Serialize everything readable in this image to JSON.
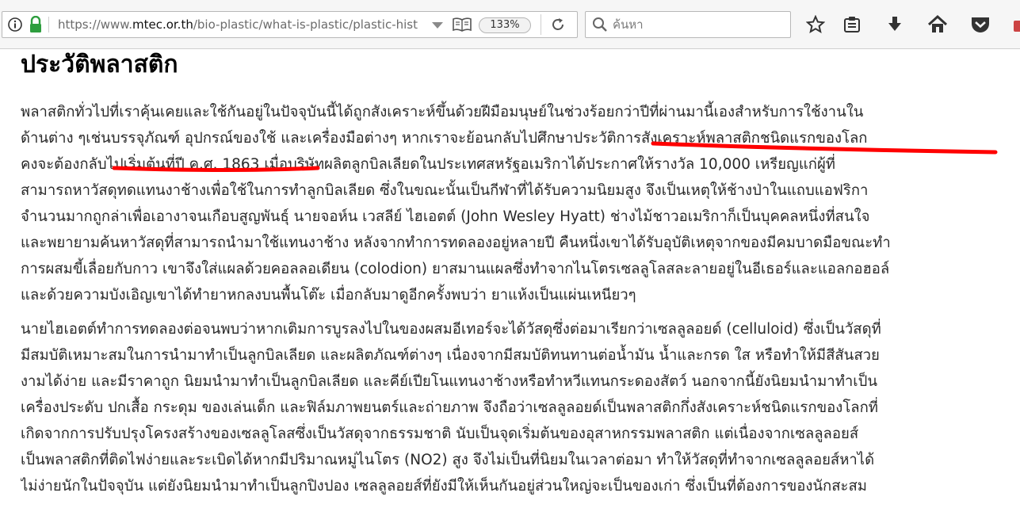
{
  "browser": {
    "url_prefix": "https://www.",
    "url_host": "mtec.or.th",
    "url_path": "/bio-plastic/what-is-plastic/plastic-hist",
    "zoom": "133%",
    "search_placeholder": "ค้นหา",
    "icons": [
      "info-icon",
      "lock-icon",
      "dropdown-icon",
      "reader-view-icon",
      "reload-icon",
      "search-icon",
      "bookmark-star-icon",
      "bookmarks-list-icon",
      "download-icon",
      "home-icon",
      "pocket-icon"
    ],
    "colors": {
      "toolbar": "#f6f6f6",
      "lock": "#2e9e3e",
      "annotation": "#ff0000"
    }
  },
  "page": {
    "title": "ประวัติพลาสติก",
    "paragraphs": [
      {
        "lines": [
          "พลาสติกทั่วไปที่เราคุ้นเคยและใช้กันอยู่ในปัจจุบันนี้ได้ถูกสังเคราะห์ขึ้นด้วยฝีมือมนุษย์ในช่วงร้อยกว่าปีที่ผ่านมานี้เองสำหรับการใช้งานใน",
          "ด้านต่าง ๆเช่นบรรจุภัณฑ์ อุปกรณ์ของใช้ และเครื่องมือต่างๆ หากเราจะย้อนกลับไปศึกษาประวัติการสังเคราะห์พลาสติกชนิดแรกของโลก",
          "คงจะต้องกลับไปเริ่มต้นที่ปี ค.ศ. 1863 เมื่อบริษัทผลิตลูกบิลเลียดในประเทศสหรัฐอเมริกาได้ประกาศให้รางวัล 10,000 เหรียญแก่ผู้ที่",
          "สามารถหาวัสดุทดแทนงาช้างเพื่อใช้ในการทำลูกบิลเลียด ซึ่งในขณะนั้นเป็นกีฬาที่ได้รับความนิยมสูง จึงเป็นเหตุให้ช้างป่าในแถบแอฟริกา",
          "จำนวนมากถูกล่าเพื่อเอางาจนเกือบสูญพันธุ์ นายจอห์น เวสลีย์ ไฮเอตต์ (John Wesley Hyatt) ช่างไม้ชาวอเมริกาก็เป็นบุคคลหนึ่งที่สนใจ",
          "และพยายามค้นหาวัสดุที่สามารถนำมาใช้แทนงาช้าง หลังจากทำการทดลองอยู่หลายปี คืนหนึ่งเขาได้รับอุบัติเหตุจากของมีคมบาดมือขณะทำ",
          "การผสมขี้เลื่อยกับกาว เขาจึงใส่แผลด้วยคอลลอเดียน (colodion) ยาสมานแผลซึ่งทำจากไนโตรเซลลูโลสละลายอยู่ในอีเธอร์และแอลกอฮอล์",
          "และด้วยความบังเอิญเขาได้ทำยาหกลงบนพื้นโต๊ะ เมื่อกลับมาดูอีกครั้งพบว่า ยาแห้งเป็นแผ่นเหนียวๆ"
        ]
      },
      {
        "lines": [
          "นายไฮเอตต์ทำการทดลองต่อจนพบว่าหากเติมการบูรลงไปในของผสมอีเทอร์จะได้วัสดุซึ่งต่อมาเรียกว่าเซลลูลอยด์ (celluloid) ซึ่งเป็นวัสดุที่",
          "มีสมบัติเหมาะสมในการนำมาทำเป็นลูกบิลเลียด และผลิตภัณฑ์ต่างๆ เนื่องจากมีสมบัติทนทานต่อน้ำมัน น้ำและกรด ใส หรือทำให้มีสีสันสวย",
          "งามได้ง่าย และมีราคาถูก นิยมนำมาทำเป็นลูกบิลเลียด และคีย์เปียโนแทนงาช้างหรือทำหวีแทนกระดองสัตว์ นอกจากนี้ยังนิยมนำมาทำเป็น",
          "เครื่องประดับ ปกเสื้อ กระดุม ของเล่นเด็ก และฟิล์มภาพยนตร์และถ่ายภาพ จึงถือว่าเซลลูลอยด์เป็นพลาสติกกึ่งสังเคราะห์ชนิดแรกของโลกที่",
          "เกิดจากการปรับปรุงโครงสร้างของเซลลูโลสซึ่งเป็นวัสดุจากธรรมชาติ นับเป็นจุดเริ่มต้นของอุสาหกรรมพลาสติก แต่เนื่องจากเซลลูลอยส์",
          "เป็นพลาสติกที่ติดไฟง่ายและระเบิดได้หากมีปริมาณหมู่ไนโตร (NO2) สูง จึงไม่เป็นที่นิยมในเวลาต่อมา ทำให้วัสดุที่ทำจากเซลลูลอยส์หาได้",
          "ไม่ง่ายนักในปัจจุบัน แต่ยังนิยมนำมาทำเป็นลูกปิงปอง เซลลูลอยส์ที่ยังมีให้เห็นกันอยู่ส่วนใหญ่จะเป็นของเก่า ซึ่งเป็นที่ต้องการของนักสะสม"
        ]
      }
    ]
  }
}
